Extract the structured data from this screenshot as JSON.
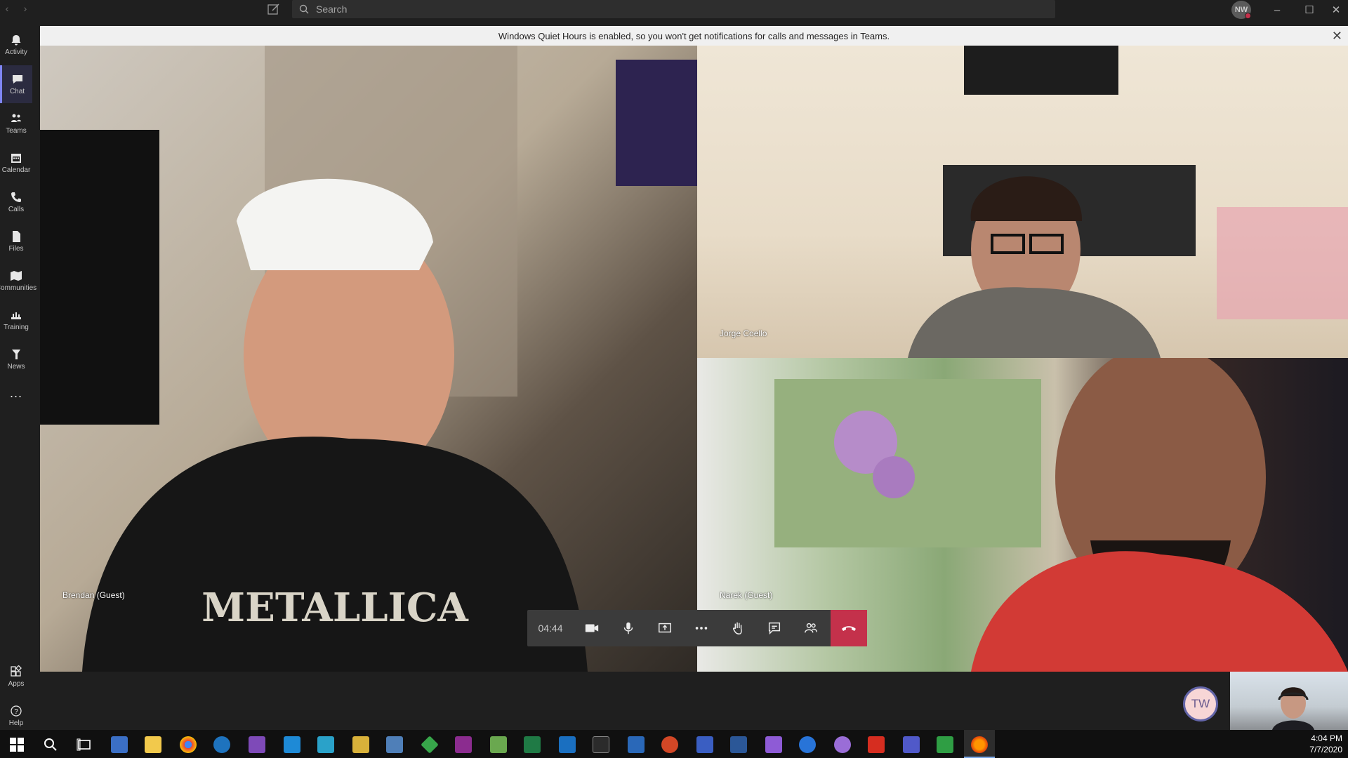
{
  "titlebar": {
    "search_placeholder": "Search",
    "user_initials": "NW"
  },
  "rail": {
    "items": [
      {
        "label": "Activity",
        "icon": "bell-icon"
      },
      {
        "label": "Chat",
        "icon": "chat-icon",
        "active": true
      },
      {
        "label": "Teams",
        "icon": "teams-icon"
      },
      {
        "label": "Calendar",
        "icon": "calendar-icon"
      },
      {
        "label": "Calls",
        "icon": "phone-icon"
      },
      {
        "label": "Files",
        "icon": "file-icon"
      },
      {
        "label": "Communities",
        "icon": "communities-icon"
      },
      {
        "label": "Training",
        "icon": "training-icon"
      },
      {
        "label": "News",
        "icon": "news-icon"
      }
    ],
    "more": "...",
    "apps_label": "Apps",
    "help_label": "Help"
  },
  "banner": {
    "message": "Windows Quiet Hours is enabled, so you won't get notifications for calls and messages in Teams."
  },
  "participants": [
    {
      "name": "Brendan (Guest)"
    },
    {
      "name": "Jorge Coello"
    },
    {
      "name": "Narek (Guest)"
    }
  ],
  "call": {
    "timer": "04:44",
    "self_initials": "TW"
  },
  "taskbar": {
    "time": "4:04 PM",
    "date": "7/7/2020"
  },
  "colors": {
    "accent": "#6264a7",
    "hangup": "#c4314b",
    "rail_bg": "#1f1f1f"
  }
}
